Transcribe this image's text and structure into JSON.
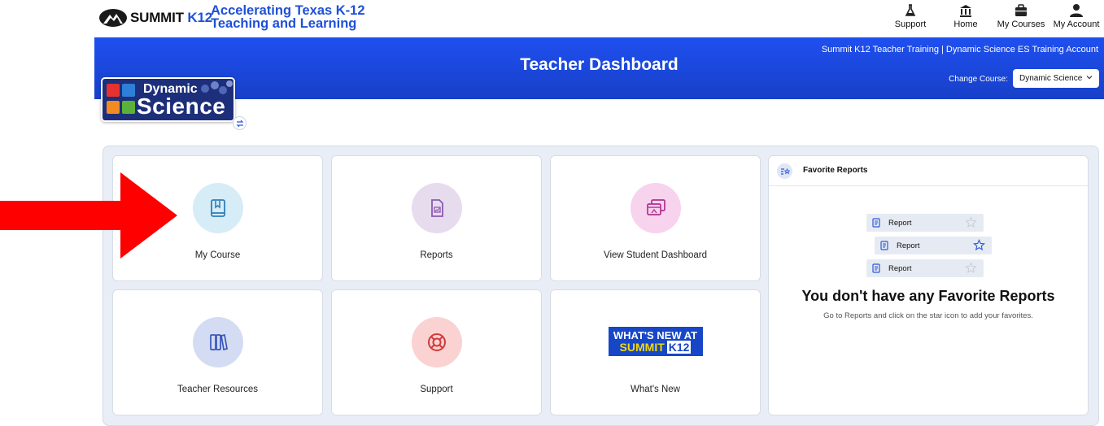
{
  "header": {
    "brand": "SUMMIT",
    "brand_suffix": "K12",
    "tagline_line1": "Accelerating Texas K-12",
    "tagline_line2": "Teaching and Learning",
    "nav": [
      {
        "label": "Support",
        "icon": "flask-icon"
      },
      {
        "label": "Home",
        "icon": "bank-icon"
      },
      {
        "label": "My Courses",
        "icon": "briefcase-icon"
      },
      {
        "label": "My Account",
        "icon": "user-icon"
      }
    ]
  },
  "banner": {
    "title": "Teacher Dashboard",
    "account": "Summit K12 Teacher Training | Dynamic Science ES Training Account",
    "change_course_label": "Change Course:",
    "selected_course": "Dynamic Science"
  },
  "course_badge": {
    "line1": "Dynamic",
    "line2": "Science"
  },
  "cards": [
    {
      "label": "My Course",
      "icon": "book-icon",
      "color": "#d6ecf7",
      "stroke": "#2f7fb5"
    },
    {
      "label": "Reports",
      "icon": "report-icon",
      "color": "#e6dcee",
      "stroke": "#8c5ab0"
    },
    {
      "label": "View Student Dashboard",
      "icon": "student-dashboard-icon",
      "color": "#f7d3ee",
      "stroke": "#b0308f"
    },
    {
      "label": "Teacher Resources",
      "icon": "books-icon",
      "color": "#d4dcf3",
      "stroke": "#3b56b8"
    },
    {
      "label": "Support",
      "icon": "lifebuoy-icon",
      "color": "#fad2d2",
      "stroke": "#d13a3a"
    },
    {
      "label": "What's New",
      "icon": "whats-new-banner"
    }
  ],
  "whats_new_banner": {
    "line1": "WHAT'S NEW AT",
    "line2": "SUMMIT",
    "line2_suffix": "K12"
  },
  "favorites": {
    "title": "Favorite Reports",
    "sample_items": [
      "Report",
      "Report",
      "Report"
    ],
    "empty_title": "You don't have any Favorite Reports",
    "empty_subtitle": "Go to Reports and click on the star icon to add your favorites."
  },
  "colors": {
    "brand_blue": "#1e50d8",
    "banner_blue": "#1f4ff0",
    "panel_bg": "#e9eef6",
    "arrow_red": "#ff0000"
  }
}
